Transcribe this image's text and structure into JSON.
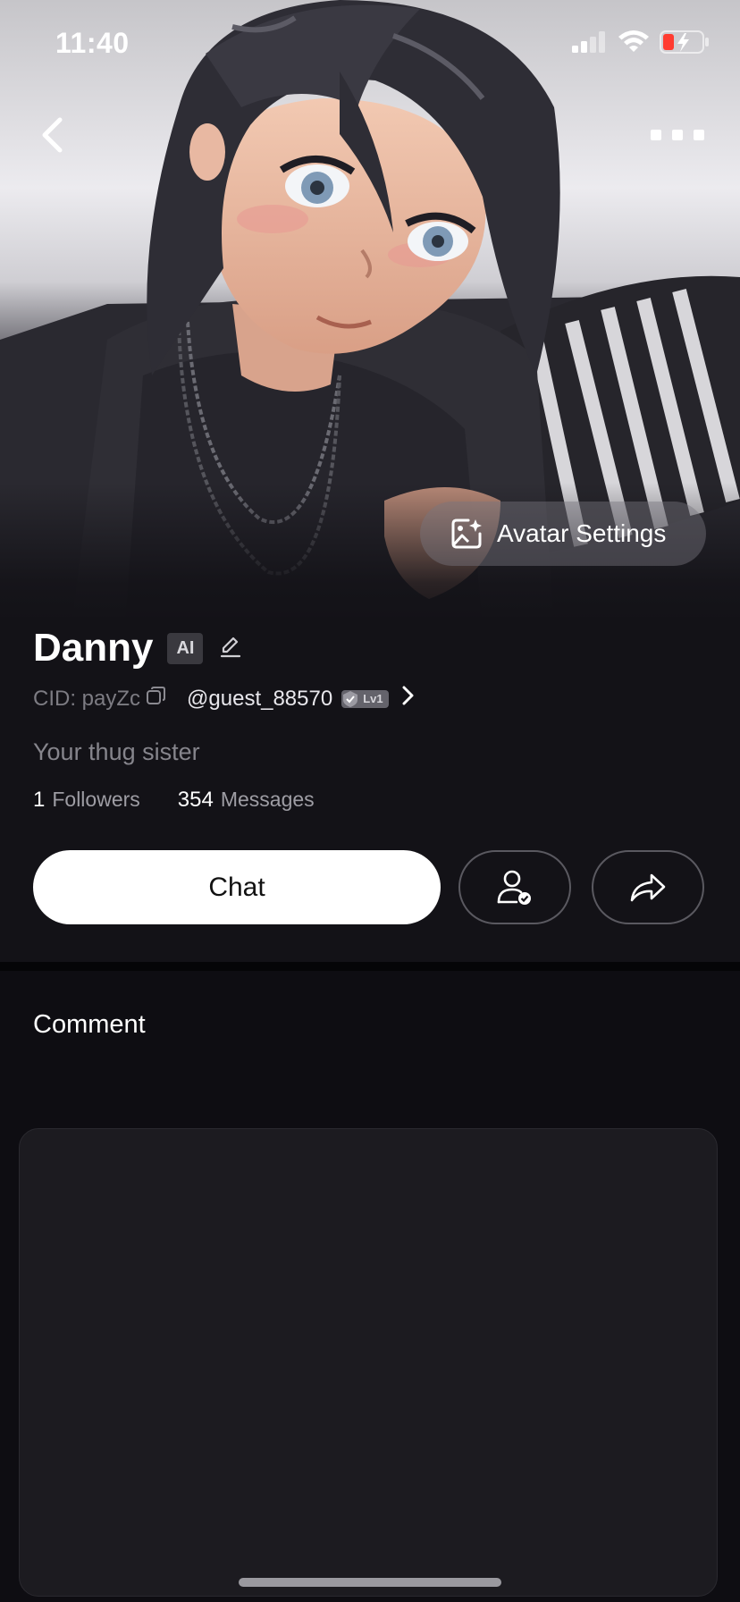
{
  "status_bar": {
    "time": "11:40"
  },
  "icons": {
    "back": "chevron-left-icon",
    "more": "more-horizontal-icon",
    "avatar_settings": "image-sparkle-icon",
    "edit": "pencil-icon",
    "copy": "copy-icon",
    "verified": "verified-badge-icon",
    "chevron": "chevron-right-icon",
    "follow": "user-check-icon",
    "share": "share-arrow-icon"
  },
  "hero": {
    "avatar_settings_label": "Avatar Settings"
  },
  "profile": {
    "name": "Danny",
    "ai_badge": "AI",
    "cid_label": "CID: payZc",
    "handle": "@guest_88570",
    "level": "Lv1",
    "bio": "Your thug sister",
    "followers_count": "1",
    "followers_label": "Followers",
    "messages_count": "354",
    "messages_label": "Messages"
  },
  "actions": {
    "chat_label": "Chat"
  },
  "comments": {
    "title": "Comment"
  },
  "colors": {
    "background": "#0c0b0f",
    "panel": "#131217",
    "comment_box": "#1c1b20",
    "battery_low": "#ff3b30"
  }
}
